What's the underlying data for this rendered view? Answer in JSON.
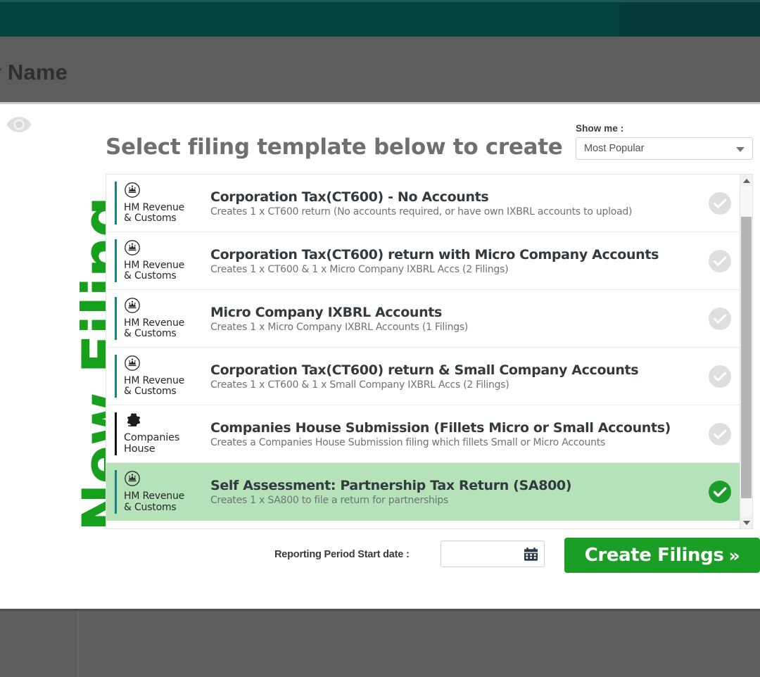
{
  "header": {
    "company_name": "any Name"
  },
  "sidebar": {
    "eye_icon": "eye-icon",
    "vertical_label": "New Filing"
  },
  "panel": {
    "title": "Select filing template below to create",
    "show_me_label": "Show me :",
    "show_me_value": "Most Popular",
    "caret_icon": "chevron-down-icon"
  },
  "templates": [
    {
      "agency": "HM Revenue & Customs",
      "agency_line1": "HM Revenue",
      "agency_line2": "& Customs",
      "crest": "hmrc-crown-icon",
      "title": "Corporation Tax(CT600) - No Accounts",
      "subtitle": "Creates 1 x CT600 return (No accounts required, or have own IXBRL accounts to upload)",
      "selected": false,
      "check_icon": "check-circle-icon"
    },
    {
      "agency": "HM Revenue & Customs",
      "agency_line1": "HM Revenue",
      "agency_line2": "& Customs",
      "crest": "hmrc-crown-icon",
      "title": "Corporation Tax(CT600) return with Micro Company Accounts",
      "subtitle": "Creates 1 x CT600 & 1 x Micro Company IXBRL Accs (2 Filings)",
      "selected": false,
      "check_icon": "check-circle-icon"
    },
    {
      "agency": "HM Revenue & Customs",
      "agency_line1": "HM Revenue",
      "agency_line2": "& Customs",
      "crest": "hmrc-crown-icon",
      "title": "Micro Company IXBRL Accounts",
      "subtitle": "Creates 1 x Micro Company IXBRL Accounts (1 Filings)",
      "selected": false,
      "check_icon": "check-circle-icon"
    },
    {
      "agency": "HM Revenue & Customs",
      "agency_line1": "HM Revenue",
      "agency_line2": "& Customs",
      "crest": "hmrc-crown-icon",
      "title": "Corporation Tax(CT600) return & Small Company Accounts",
      "subtitle": "Creates 1 x CT600 & 1 x Small Company IXBRL Accs (2 Filings)",
      "selected": false,
      "check_icon": "check-circle-icon"
    },
    {
      "agency": "Companies House",
      "agency_line1": "Companies",
      "agency_line2": "House",
      "crest": "companies-house-crest-icon",
      "title": "Companies House Submission (Fillets Micro or Small Accounts)",
      "subtitle": "Creates a Companies House Submission filing which fillets Small or Micro Accounts",
      "selected": false,
      "check_icon": "check-circle-icon"
    },
    {
      "agency": "HM Revenue & Customs",
      "agency_line1": "HM Revenue",
      "agency_line2": "& Customs",
      "crest": "hmrc-crown-icon",
      "title": "Self Assessment: Partnership Tax Return (SA800)",
      "subtitle": "Creates 1 x SA800 to file a return for partnerships",
      "selected": true,
      "check_icon": "check-circle-filled-icon"
    }
  ],
  "footer": {
    "date_label": "Reporting Period Start date :",
    "date_value": "",
    "date_placeholder": "",
    "calendar_icon": "calendar-icon",
    "create_label": "Create Filings",
    "create_chevron": "»"
  },
  "colors": {
    "topbar": "#023B37",
    "band_grey": "#5d5d5d",
    "brand_green": "#16a01c",
    "button_green": "#1a9e26",
    "selected_row": "#b5e2b9",
    "hmrc_teal": "#13847f",
    "title_grey": "#6f6f6f"
  }
}
